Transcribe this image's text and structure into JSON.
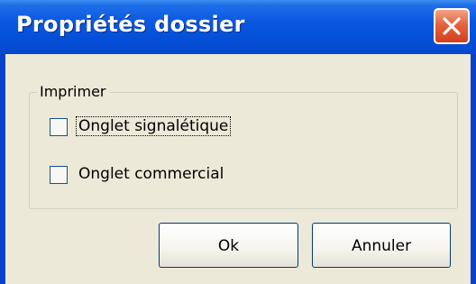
{
  "window": {
    "title": "Propriétés dossier",
    "close_icon": "close-icon"
  },
  "group": {
    "legend": "Imprimer",
    "options": [
      {
        "label": "Onglet signalétique",
        "checked": false,
        "focused": true
      },
      {
        "label": "Onglet commercial",
        "checked": false,
        "focused": false
      }
    ]
  },
  "buttons": {
    "ok_label": "Ok",
    "cancel_label": "Annuler"
  },
  "colors": {
    "titlebar": "#0550d8",
    "close_button": "#e4633f",
    "dialog_background": "#ece9d8"
  }
}
